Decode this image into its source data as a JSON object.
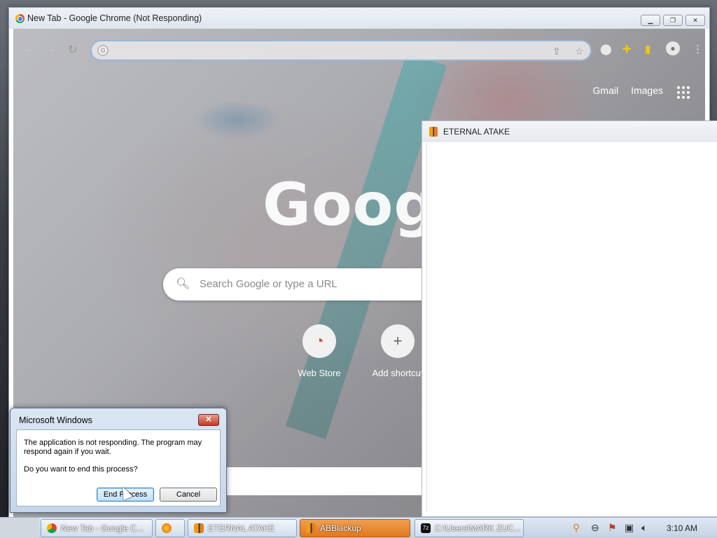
{
  "chrome": {
    "title": "New Tab - Google Chrome (Not Responding)",
    "gmail": "Gmail",
    "images": "Images",
    "logo_text": "Googl",
    "search_placeholder": "Search Google or type a URL",
    "shortcuts": [
      {
        "label": "Web Store"
      },
      {
        "label": "Add shortcut"
      }
    ]
  },
  "ea_window": {
    "title": "ETERNAL ATAKE"
  },
  "dialog": {
    "title": "Microsoft Windows",
    "close": "✕",
    "message": "The application is not responding. The program may respond again if you wait.",
    "question": "Do you want to end this process?",
    "end_button": "End Process",
    "cancel_button": "Cancel"
  },
  "taskbar": {
    "items": [
      {
        "label": "New Tab - Google C..."
      },
      {
        "label": ""
      },
      {
        "label": "ETERNAL ATAKE"
      },
      {
        "label": "ABBlackup"
      },
      {
        "label": "C:\\Users\\MARK ZUC..."
      }
    ],
    "clock": "3:10 AM"
  },
  "colors": {
    "dialog_close": "#c0392b",
    "taskbar_active": "#e07820",
    "omnibox_border": "#9ab4d4"
  },
  "icons": [
    "chrome-logo-icon",
    "back-icon",
    "forward-icon",
    "reload-icon",
    "share-icon",
    "star-icon",
    "extension-icon",
    "puzzle-icon",
    "sidebar-icon",
    "profile-icon",
    "menu-icon",
    "apps-grid-icon",
    "search-icon",
    "webstore-icon",
    "plus-icon",
    "firefox-icon",
    "7zip-icon",
    "search-tray-icon",
    "network-icon",
    "volume-icon",
    "action-center-icon"
  ]
}
